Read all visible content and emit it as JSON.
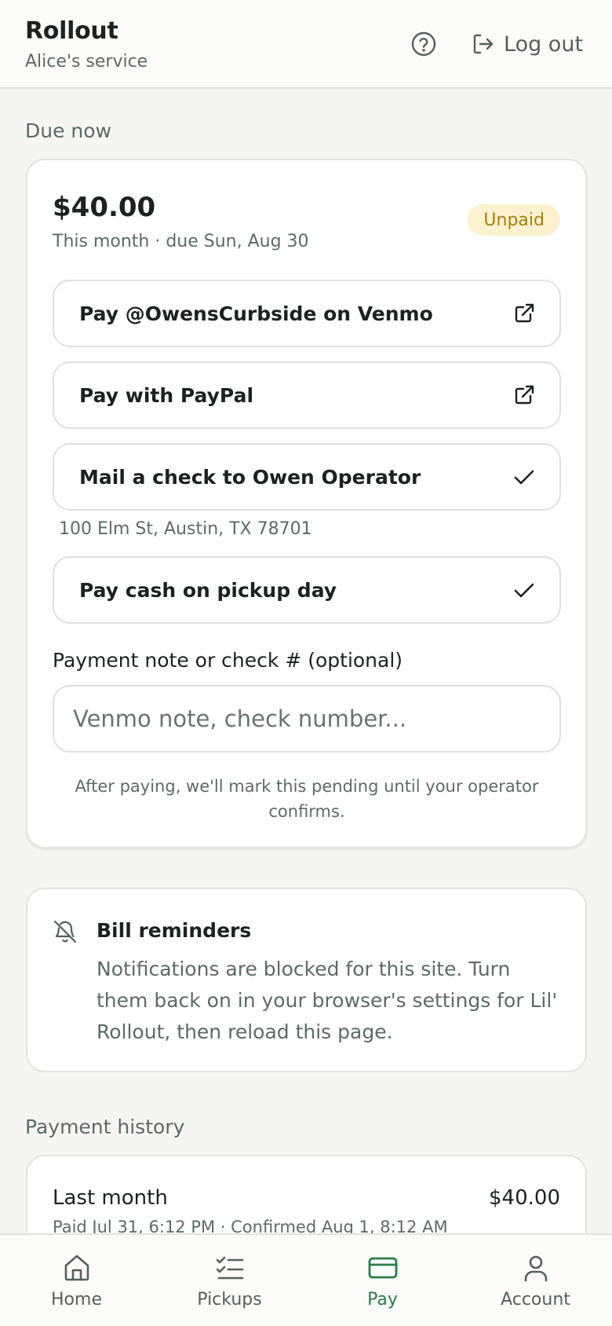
{
  "header": {
    "title": "Rollout",
    "subtitle": "Alice's service",
    "help_icon": "help-circle-icon",
    "logout_label": "Log out",
    "logout_icon": "log-out-icon"
  },
  "due_now": {
    "section_title": "Due now",
    "amount": "$40.00",
    "subtitle": "This month · due Sun, Aug 30",
    "status_badge": "Unpaid",
    "options": [
      {
        "label": "Pay @OwensCurbside on Venmo",
        "icon": "external-link-icon"
      },
      {
        "label": "Pay with PayPal",
        "icon": "external-link-icon"
      },
      {
        "label": "Mail a check to Owen Operator",
        "icon": "check-icon"
      },
      {
        "label": "Pay cash on pickup day",
        "icon": "check-icon"
      }
    ],
    "check_address": "100 Elm St, Austin, TX 78701",
    "note_label": "Payment note or check # (optional)",
    "note_placeholder": "Venmo note, check number...",
    "note_value": "",
    "after_pay_text": "After paying, we'll mark this pending until your operator confirms."
  },
  "reminders": {
    "icon": "bell-off-icon",
    "title": "Bill reminders",
    "text": "Notifications are blocked for this site. Turn them back on in your browser's settings for Lil' Rollout, then reload this page."
  },
  "history": {
    "section_title": "Payment history",
    "items": [
      {
        "label": "Last month",
        "amount": "$40.00",
        "detail": "Paid Jul 31, 6:12 PM · Confirmed Aug 1, 8:12 AM"
      }
    ]
  },
  "nav": {
    "active": "Pay",
    "items": [
      {
        "label": "Home",
        "icon": "home-icon"
      },
      {
        "label": "Pickups",
        "icon": "list-checks-icon"
      },
      {
        "label": "Pay",
        "icon": "credit-card-icon"
      },
      {
        "label": "Account",
        "icon": "user-icon"
      }
    ]
  },
  "colors": {
    "accent": "#2b7d4b",
    "badge_bg": "#fcf1cf",
    "badge_text": "#a97d0f",
    "muted_text": "#5f6a64",
    "background": "#f5f5f3"
  }
}
